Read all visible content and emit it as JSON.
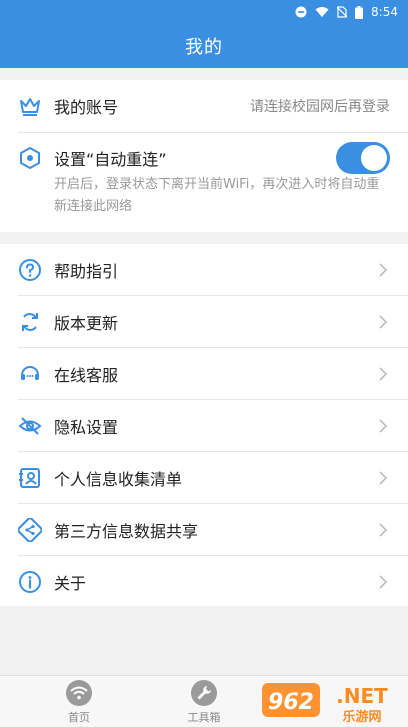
{
  "status_bar": {
    "time": "8:54"
  },
  "header": {
    "title": "我的"
  },
  "account": {
    "label": "我的账号",
    "hint": "请连接校园网后再登录"
  },
  "auto_reconnect": {
    "label": "设置“自动重连”",
    "enabled": true,
    "description": "开启后，登录状态下离开当前WiFi，再次进入时将自动重新连接此网络"
  },
  "menu": [
    {
      "label": "帮助指引",
      "icon": "help-icon"
    },
    {
      "label": "版本更新",
      "icon": "refresh-icon"
    },
    {
      "label": "在线客服",
      "icon": "headset-icon"
    },
    {
      "label": "隐私设置",
      "icon": "eye-off-icon"
    },
    {
      "label": "个人信息收集清单",
      "icon": "id-card-icon"
    },
    {
      "label": "第三方信息数据共享",
      "icon": "share-icon"
    },
    {
      "label": "关于",
      "icon": "info-icon"
    }
  ],
  "tabs": [
    {
      "label": "首页",
      "icon": "wifi-icon"
    },
    {
      "label": "工具箱",
      "icon": "wrench-icon"
    }
  ],
  "watermark": {
    "text": "962.NET",
    "subtext": "乐游网"
  },
  "colors": {
    "primary": "#3b8fe3",
    "background": "#f2f2f2"
  }
}
